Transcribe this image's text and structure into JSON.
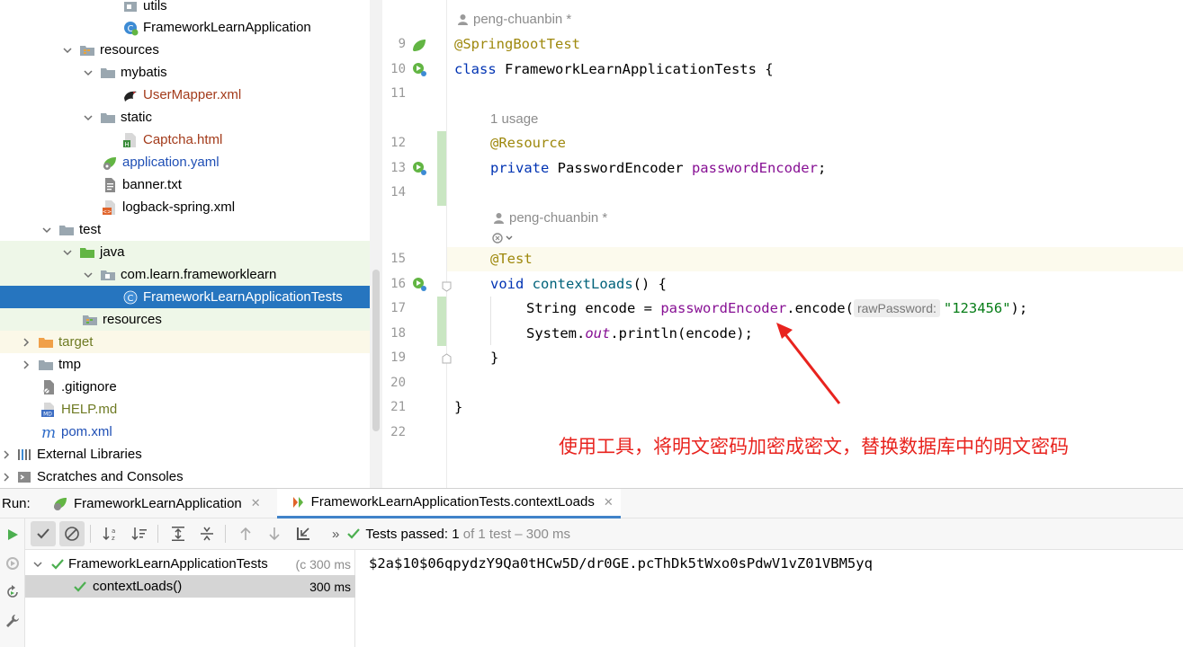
{
  "project_tree": {
    "items": [
      {
        "label": "utils",
        "color": "default"
      },
      {
        "label": "FrameworkLearnApplication",
        "color": "default"
      },
      {
        "label": "resources",
        "color": "default"
      },
      {
        "label": "mybatis",
        "color": "default"
      },
      {
        "label": "UserMapper.xml",
        "color": "red"
      },
      {
        "label": "static",
        "color": "default"
      },
      {
        "label": "Captcha.html",
        "color": "red"
      },
      {
        "label": "application.yaml",
        "color": "blue"
      },
      {
        "label": "banner.txt",
        "color": "default"
      },
      {
        "label": "logback-spring.xml",
        "color": "default"
      },
      {
        "label": "test",
        "color": "default"
      },
      {
        "label": "java",
        "color": "default"
      },
      {
        "label": "com.learn.frameworklearn",
        "color": "default"
      },
      {
        "label": "FrameworkLearnApplicationTests",
        "color": "selected"
      },
      {
        "label": "resources",
        "color": "default"
      },
      {
        "label": "target",
        "color": "olive"
      },
      {
        "label": "tmp",
        "color": "default"
      },
      {
        "label": ".gitignore",
        "color": "default"
      },
      {
        "label": "HELP.md",
        "color": "olive"
      },
      {
        "label": "pom.xml",
        "color": "blue"
      },
      {
        "label": "External Libraries",
        "color": "default"
      },
      {
        "label": "Scratches and Consoles",
        "color": "default"
      }
    ]
  },
  "editor": {
    "line_numbers": [
      "9",
      "10",
      "11",
      "12",
      "13",
      "14",
      "15",
      "16",
      "17",
      "18",
      "19",
      "20",
      "21",
      "22"
    ],
    "hints": {
      "author_1": "peng-chuanbin *",
      "usage": "1 usage",
      "author_2": "peng-chuanbin *"
    },
    "code": {
      "l9_ann": "@SpringBootTest",
      "l10_kw": "class",
      "l10_rest": " FrameworkLearnApplicationTests {",
      "l12_ann": "@Resource",
      "l13_kw": "private",
      "l13_type": " PasswordEncoder ",
      "l13_field": "passwordEncoder",
      "l13_end": ";",
      "l15_ann": "@Test",
      "l16_kw": "void",
      "l16_name": "contextLoads",
      "l16_end": "() {",
      "l17_a": "String encode = ",
      "l17_field": "passwordEncoder",
      "l17_b": ".encode(",
      "l17_hint": "rawPassword:",
      "l17_str": "\"123456\"",
      "l17_end": ");",
      "l18_a": "System.",
      "l18_static": "out",
      "l18_b": ".println(encode);",
      "l19": "}",
      "l21": "}"
    },
    "annotation": "使用工具，将明文密码加密成密文，替换数据库中的明文密码",
    "annotation_color": "#e8231e"
  },
  "run_panel": {
    "label": "Run:",
    "tabs": [
      {
        "label": "FrameworkLearnApplication",
        "close": "✕"
      },
      {
        "label": "FrameworkLearnApplicationTests.contextLoads",
        "close": "✕"
      }
    ],
    "status": {
      "prefix": "Tests passed:",
      "count": "1",
      "suffix": "of 1 test – 300 ms"
    },
    "overflow": "»",
    "test_tree": [
      {
        "label": "FrameworkLearnApplicationTests",
        "duration": "(c 300 ms"
      },
      {
        "label": "contextLoads()",
        "duration": "300 ms"
      }
    ],
    "console_output": "$2a$10$06qpydzY9Qa0tHCw5D/dr0GE.pcThDk5tWxo0sPdwV1vZ01VBM5yq"
  },
  "colors": {
    "selection": "#2675bf",
    "pass_green": "#4caf50",
    "annotation_red": "#e8231e"
  }
}
